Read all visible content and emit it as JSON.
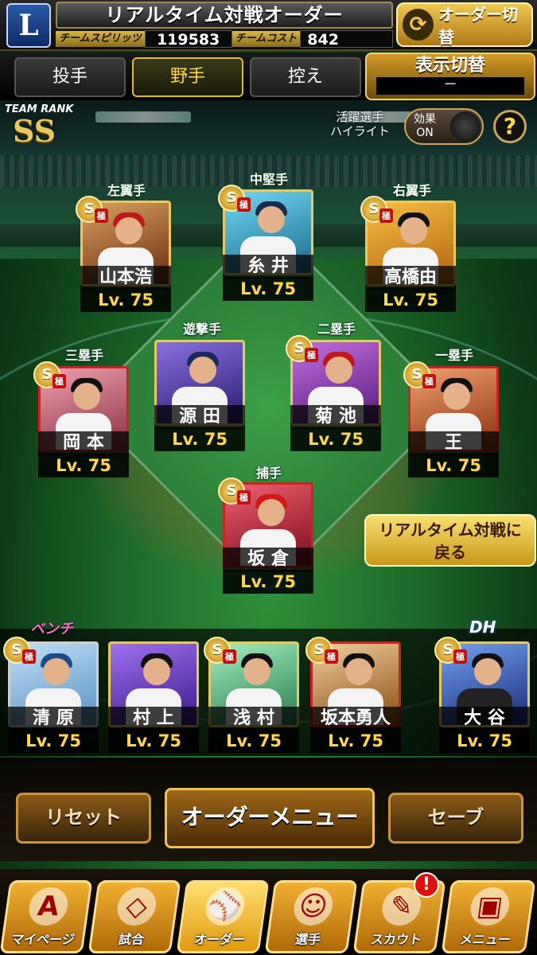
{
  "header": {
    "title": "リアルタイム対戦オーダー",
    "logo_text": "L",
    "spirit_label": "チームスピリッツ",
    "spirit_value": "119583",
    "cost_label": "チームコスト",
    "cost_value": "842",
    "order_switch_label": "オーダー切替",
    "order_switch_icon": "swap-icon"
  },
  "tabs": [
    {
      "label": "投手"
    },
    {
      "label": "野手"
    },
    {
      "label": "控え"
    }
  ],
  "active_tab": "野手",
  "display_switch": {
    "label": "表示切替",
    "value": "－"
  },
  "team_rank": {
    "label": "TEAM RANK",
    "value": "SS"
  },
  "highlight": {
    "label_line1": "活躍選手",
    "label_line2": "ハイライト",
    "effect_label": "効果",
    "state": "ON"
  },
  "help_label": "?",
  "positions": {
    "lf": "左翼手",
    "cf": "中堅手",
    "rf": "右翼手",
    "ss": "遊撃手",
    "b2": "二塁手",
    "b3": "三塁手",
    "b1": "一塁手",
    "c": "捕手"
  },
  "players": {
    "lf": {
      "name": "山本浩",
      "level": "Lv. 75"
    },
    "cf": {
      "name": "糸 井",
      "level": "Lv. 75"
    },
    "rf": {
      "name": "高橋由",
      "level": "Lv. 75"
    },
    "ss": {
      "name": "源 田",
      "level": "Lv. 75"
    },
    "b2": {
      "name": "菊 池",
      "level": "Lv. 75"
    },
    "b3": {
      "name": "岡 本",
      "level": "Lv. 75"
    },
    "b1": {
      "name": "王",
      "level": "Lv. 75"
    },
    "c": {
      "name": "坂 倉",
      "level": "Lv. 75"
    }
  },
  "back_button": {
    "line1": "リアルタイム対戦に",
    "line2": "戻る"
  },
  "bench_label": "ベンチ",
  "dh_label": "DH",
  "bench": [
    {
      "name": "清 原",
      "level": "Lv. 75"
    },
    {
      "name": "村 上",
      "level": "Lv. 75"
    },
    {
      "name": "浅 村",
      "level": "Lv. 75"
    },
    {
      "name": "坂本勇人",
      "level": "Lv. 75"
    }
  ],
  "dh": {
    "name": "大 谷",
    "level": "Lv. 75"
  },
  "card_badge": "S",
  "card_tag": "極",
  "buttons": {
    "reset": "リセット",
    "order_menu": "オーダーメニュー",
    "save": "セーブ"
  },
  "nav": [
    {
      "label": "マイページ",
      "icon": "A"
    },
    {
      "label": "試合",
      "icon": "stadium-icon"
    },
    {
      "label": "オーダー",
      "icon": "order-icon"
    },
    {
      "label": "選手",
      "icon": "player-icon"
    },
    {
      "label": "スカウト",
      "icon": "scout-icon"
    },
    {
      "label": "メニュー",
      "icon": "menu-icon"
    }
  ],
  "notification_badge": "!",
  "colors": {
    "accent_gold": "#e8c860",
    "level_yellow": "#ffd64a",
    "bench_pink": "#ff66cc",
    "notify_red": "#e01010"
  }
}
